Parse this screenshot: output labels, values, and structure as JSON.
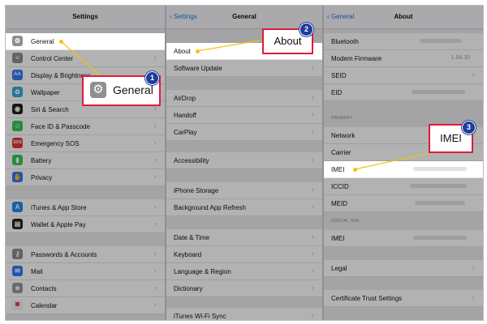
{
  "panel1": {
    "title": "Settings",
    "items": [
      {
        "label": "General",
        "icon": "gear-icon",
        "color": "#8e8e93"
      },
      {
        "label": "Control Center",
        "icon": "sliders-icon",
        "color": "#8e8e93"
      },
      {
        "label": "Display & Brightness",
        "icon": "text-size-icon",
        "color": "#3478f6"
      },
      {
        "label": "Wallpaper",
        "icon": "flower-icon",
        "color": "#36a8dd"
      },
      {
        "label": "Siri & Search",
        "icon": "siri-icon",
        "color": "#222222"
      },
      {
        "label": "Face ID & Passcode",
        "icon": "face-id-icon",
        "color": "#34c759"
      },
      {
        "label": "Emergency SOS",
        "icon": "sos-icon",
        "color": "#e5372f"
      },
      {
        "label": "Battery",
        "icon": "battery-icon",
        "color": "#34c759"
      },
      {
        "label": "Privacy",
        "icon": "hand-icon",
        "color": "#3478f6"
      },
      {
        "label": "iTunes & App Store",
        "icon": "app-store-icon",
        "color": "#1f8bf0"
      },
      {
        "label": "Wallet & Apple Pay",
        "icon": "wallet-icon",
        "color": "#222222"
      },
      {
        "label": "Passwords & Accounts",
        "icon": "key-icon",
        "color": "#8e8e93"
      },
      {
        "label": "Mail",
        "icon": "mail-icon",
        "color": "#3478f6"
      },
      {
        "label": "Contacts",
        "icon": "contacts-icon",
        "color": "#9b9b9f"
      },
      {
        "label": "Calendar",
        "icon": "calendar-icon",
        "color": "#f2f2f2"
      }
    ],
    "callout": {
      "label": "General",
      "step": "1",
      "icon": "gear-icon"
    }
  },
  "panel2": {
    "back": "Settings",
    "title": "General",
    "items": [
      {
        "label": "About"
      },
      {
        "label": "Software Update"
      },
      {
        "label": "AirDrop"
      },
      {
        "label": "Handoff"
      },
      {
        "label": "CarPlay"
      },
      {
        "label": "Accessibility"
      },
      {
        "label": "iPhone Storage"
      },
      {
        "label": "Background App Refresh"
      },
      {
        "label": "Date & Time"
      },
      {
        "label": "Keyboard"
      },
      {
        "label": "Language & Region"
      },
      {
        "label": "Dictionary"
      },
      {
        "label": "iTunes Wi-Fi Sync"
      }
    ],
    "callout": {
      "label": "About",
      "step": "2"
    }
  },
  "panel3": {
    "back": "General",
    "title": "About",
    "items": [
      {
        "label": "Bluetooth"
      },
      {
        "label": "Modem Firmware",
        "value": "1.04.30"
      },
      {
        "label": "SEID"
      },
      {
        "label": "EID"
      },
      {
        "label": "Network"
      },
      {
        "label": "Carrier"
      },
      {
        "label": "IMEI"
      },
      {
        "label": "ICCID"
      },
      {
        "label": "MEID"
      },
      {
        "label": "IMEI"
      },
      {
        "label": "Legal"
      },
      {
        "label": "Certificate Trust Settings"
      }
    ],
    "sections": {
      "primary": "PRIMARY",
      "digital_sim": "DIGITAL SIM"
    },
    "callout": {
      "label": "IMEI",
      "step": "3"
    }
  },
  "colors": {
    "accent": "#1f74e8",
    "callout_border": "#e01b3a",
    "badge": "#1f3c9a",
    "pointer": "#f2c40f"
  }
}
